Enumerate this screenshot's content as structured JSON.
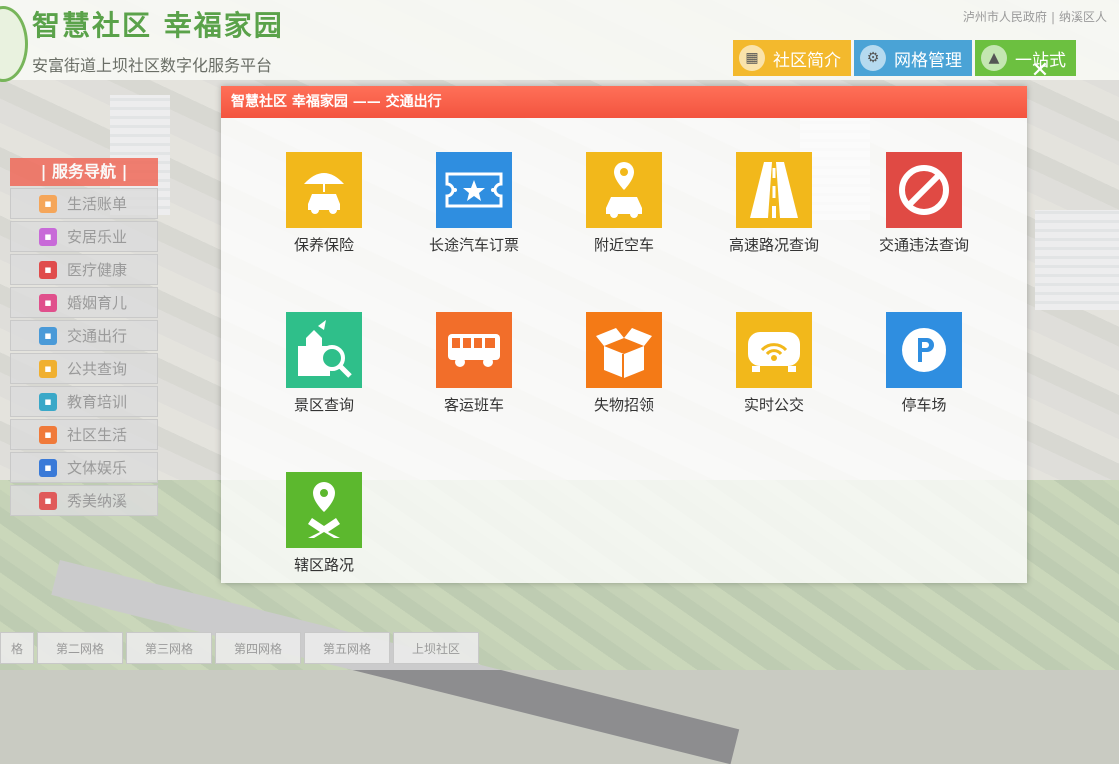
{
  "header": {
    "title": "智慧社区 幸福家园",
    "subtitle": "安富街道上坝社区数字化服务平台",
    "gov_links": [
      "泸州市人民政府",
      "纳溪区人"
    ]
  },
  "topnav": [
    {
      "label": "社区简介",
      "icon": "building-icon",
      "color": "#f3b92d"
    },
    {
      "label": "网格管理",
      "icon": "gear-icon",
      "color": "#4aa3d6"
    },
    {
      "label": "一站式",
      "icon": "rocket-icon",
      "color": "#6cc040"
    }
  ],
  "sidenav": {
    "title": "| 服务导航 |",
    "items": [
      {
        "label": "生活账单",
        "color": "#f5a65a"
      },
      {
        "label": "安居乐业",
        "color": "#c86ad8"
      },
      {
        "label": "医疗健康",
        "color": "#e04c4c"
      },
      {
        "label": "婚姻育儿",
        "color": "#e0508c"
      },
      {
        "label": "交通出行",
        "color": "#4a9ad8"
      },
      {
        "label": "公共查询",
        "color": "#f0b030"
      },
      {
        "label": "教育培训",
        "color": "#3aa8c8"
      },
      {
        "label": "社区生活",
        "color": "#f07a3a"
      },
      {
        "label": "文体娱乐",
        "color": "#3a7ad8"
      },
      {
        "label": "秀美纳溪",
        "color": "#e05a5a"
      }
    ]
  },
  "bottom_tabs": [
    "格",
    "第二网格",
    "第三网格",
    "第四网格",
    "第五网格",
    "上坝社区"
  ],
  "modal": {
    "title": "智慧社区  幸福家园  ——  交通出行",
    "tiles": [
      {
        "label": "保养保险",
        "icon": "umbrella-car-icon",
        "color": "#f2b81b"
      },
      {
        "label": "长途汽车订票",
        "icon": "ticket-icon",
        "color": "#2f8ee0"
      },
      {
        "label": "附近空车",
        "icon": "car-location-icon",
        "color": "#f2b81b"
      },
      {
        "label": "高速路况查询",
        "icon": "highway-icon",
        "color": "#f2b81b"
      },
      {
        "label": "交通违法查询",
        "icon": "no-entry-icon",
        "color": "#e04a44"
      },
      {
        "label": "景区查询",
        "icon": "scenic-search-icon",
        "color": "#2fbf8a"
      },
      {
        "label": "客运班车",
        "icon": "bus-icon",
        "color": "#f26e2a"
      },
      {
        "label": "失物招领",
        "icon": "open-box-icon",
        "color": "#f47a16"
      },
      {
        "label": "实时公交",
        "icon": "live-bus-icon",
        "color": "#f2b81b"
      },
      {
        "label": "停车场",
        "icon": "parking-icon",
        "color": "#2f8ee0"
      },
      {
        "label": "辖区路况",
        "icon": "map-pin-route-icon",
        "color": "#5cb82e"
      }
    ]
  }
}
